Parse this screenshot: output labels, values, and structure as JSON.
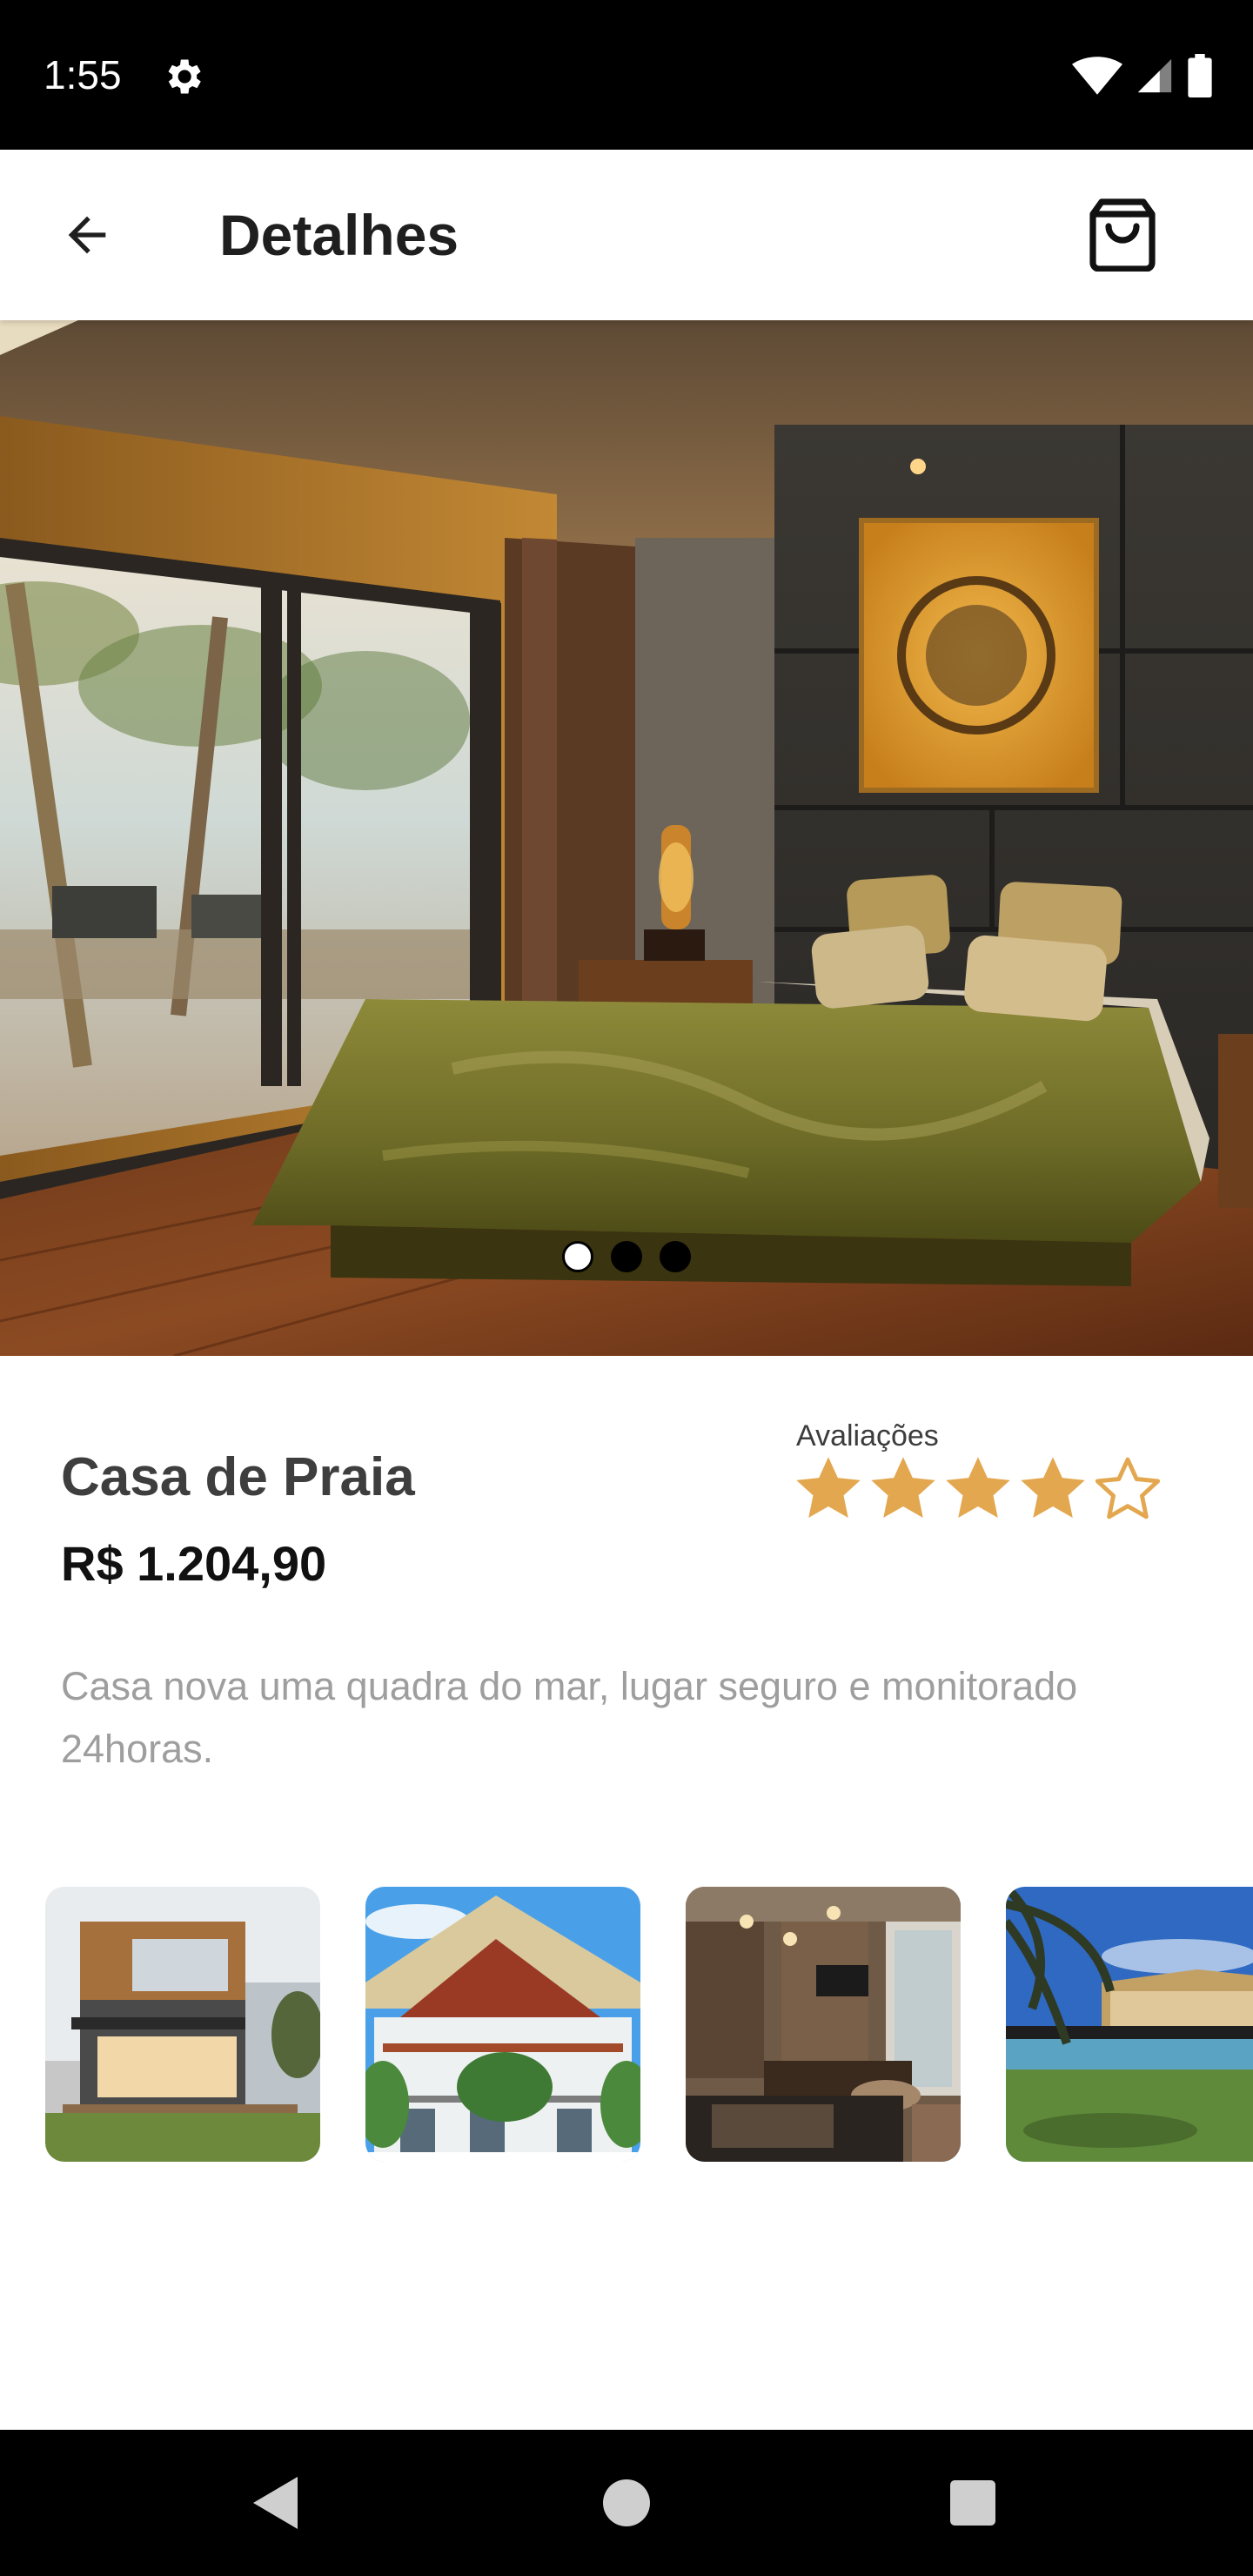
{
  "status_bar": {
    "time": "1:55"
  },
  "app_bar": {
    "title": "Detalhes"
  },
  "hero": {
    "slide_count": 3,
    "active_slide": 1
  },
  "product": {
    "name": "Casa de Praia",
    "price": "R$ 1.204,90",
    "rating_label": "Avaliações",
    "rating": 4,
    "rating_max": 5,
    "description": "Casa nova uma quadra do mar, lugar seguro e monitorado 24horas."
  },
  "thumbnails": [
    {
      "name": "modern-house-photo"
    },
    {
      "name": "beach-house-photo"
    },
    {
      "name": "living-room-photo"
    },
    {
      "name": "pool-resort-photo"
    }
  ],
  "colors": {
    "star": "#e3a74f",
    "title": "#3e3e3e",
    "description": "#9e9e9e"
  }
}
